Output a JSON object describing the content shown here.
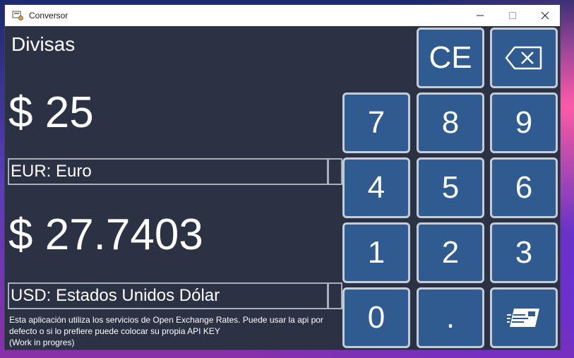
{
  "window": {
    "title": "Conversor",
    "controls": {
      "minimize": "minimize-icon",
      "maximize": "maximize-icon",
      "close": "close-icon"
    }
  },
  "main": {
    "mode_title": "Divisas",
    "from_amount": "$ 25",
    "from_currency": "EUR: Euro",
    "to_amount": "$ 27.7403",
    "to_currency": "USD: Estados Unidos Dólar",
    "footnote": "Esta aplicación utiliza los servicios de Open Exchange Rates. Puede usar la api por defecto o si lo prefiere puede colocar su propia API KEY",
    "footnote_2": "(Work in progres)"
  },
  "keypad": {
    "ce": "CE",
    "backspace_icon": "backspace-icon",
    "k7": "7",
    "k8": "8",
    "k9": "9",
    "k4": "4",
    "k5": "5",
    "k6": "6",
    "k1": "1",
    "k2": "2",
    "k3": "3",
    "k0": "0",
    "dot": ".",
    "card_icon": "currency-card-icon"
  },
  "colors": {
    "window_bg": "#2b3244",
    "key_bg": "#2f5b91",
    "key_border": "#c6ccd4",
    "text": "#ffffff"
  }
}
